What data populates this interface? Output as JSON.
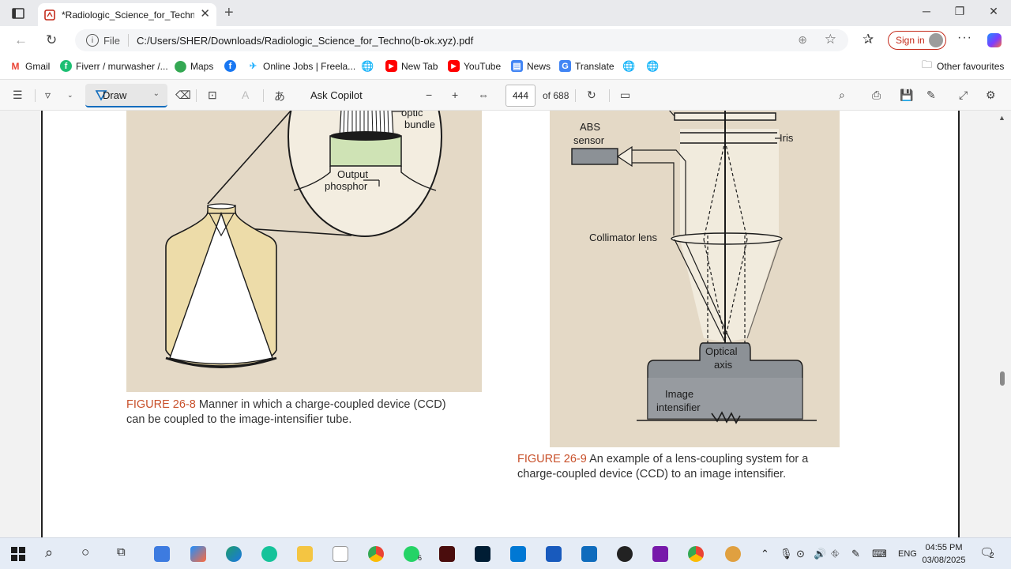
{
  "browser": {
    "tab_title": "*Radiologic_Science_for_Techno(b",
    "file_label": "File",
    "url": "C:/Users/SHER/Downloads/Radiologic_Science_for_Techno(b-ok.xyz).pdf",
    "signin_label": "Sign in"
  },
  "bookmarks": {
    "items": [
      {
        "label": "Gmail",
        "icon": "gmail-icon"
      },
      {
        "label": "Fiverr / murwasher /...",
        "icon": "fiverr-icon"
      },
      {
        "label": "Maps",
        "icon": "maps-icon"
      },
      {
        "label": "",
        "icon": "facebook-icon"
      },
      {
        "label": "Online Jobs | Freela...",
        "icon": "freelancer-icon"
      },
      {
        "label": "",
        "icon": "globe-icon"
      },
      {
        "label": "New Tab",
        "icon": "youtube-icon"
      },
      {
        "label": "YouTube",
        "icon": "youtube-icon"
      },
      {
        "label": "News",
        "icon": "news-icon"
      },
      {
        "label": "Translate",
        "icon": "translate-icon"
      }
    ],
    "other": "Other favourites"
  },
  "pdf_toolbar": {
    "draw_label": "Draw",
    "copilot_label": "Ask Copilot",
    "page_number": "444",
    "page_total": "of 688"
  },
  "figure1": {
    "labels": {
      "optic": "optic",
      "bundle": "bundle",
      "output": "Output",
      "phosphor": "phosphor"
    },
    "caption_number": "FIGURE 26-8",
    "caption_line1": "Manner in which a charge-coupled device (CCD)",
    "caption_line2": "can be coupled to the image-intensifier tube."
  },
  "figure2": {
    "labels": {
      "lens": "lens",
      "abs": "ABS",
      "sensor": "sensor",
      "iris": "Iris",
      "collimator": "Collimator lens",
      "optical": "Optical",
      "axis": "axis",
      "image": "Image",
      "intensifier": "intensifier"
    },
    "caption_number": "FIGURE 26-9",
    "caption_line1": "An example of a lens-coupling system for a",
    "caption_line2": "charge-coupled device (CCD) to an image intensifier."
  },
  "taskbar": {
    "lang": "ENG",
    "time": "04:55 PM",
    "date": "03/08/2025",
    "whatsapp_badge": "6",
    "notif_count": "2"
  }
}
